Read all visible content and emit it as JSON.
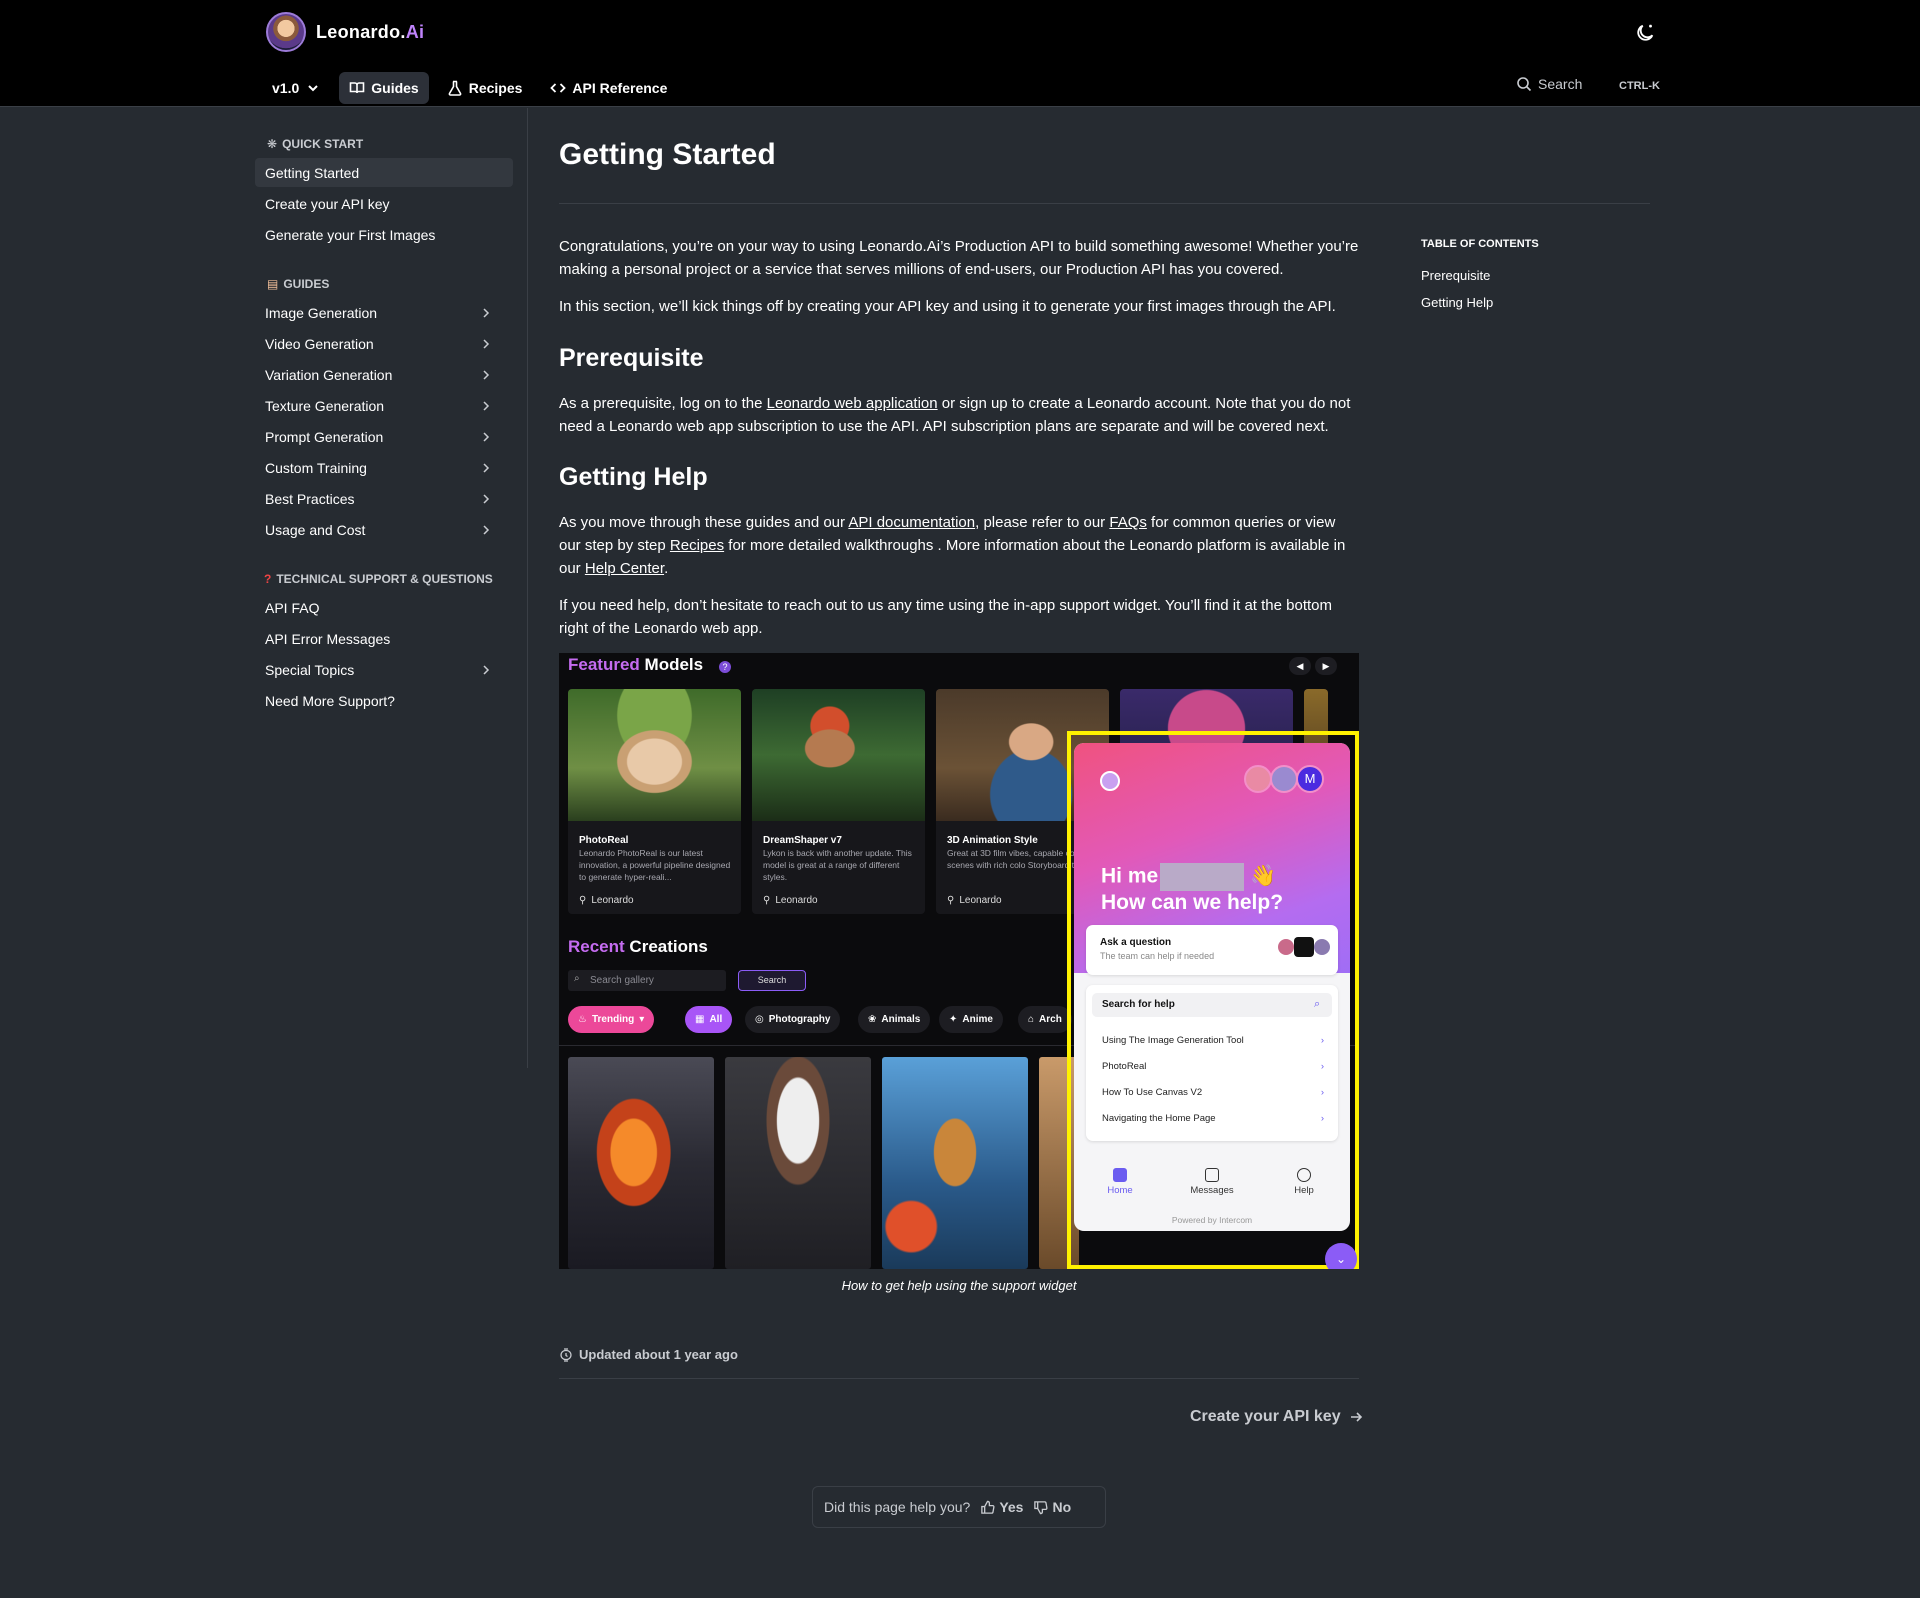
{
  "header": {
    "brand": "Leonardo.",
    "brand_ai": "Ai",
    "version": "v1.0",
    "nav": [
      "Guides",
      "Recipes",
      "API Reference"
    ],
    "search_label": "Search",
    "shortcut": "CTRL-K"
  },
  "sidebar": {
    "quick_start_title": "QUICK START",
    "quick_start": [
      "Getting Started",
      "Create your API key",
      "Generate your First Images"
    ],
    "guides_title": "GUIDES",
    "guides": [
      "Image Generation",
      "Video Generation",
      "Variation Generation",
      "Texture Generation",
      "Prompt Generation",
      "Custom Training",
      "Best Practices",
      "Usage and Cost"
    ],
    "support_title": "TECHNICAL SUPPORT & QUESTIONS",
    "support": [
      "API FAQ",
      "API Error Messages",
      "Special Topics",
      "Need More Support?"
    ]
  },
  "main": {
    "title": "Getting Started",
    "intro_1": "Congratulations, you’re on your way to using Leonardo.Ai’s Production API to build something awesome! Whether you’re making a personal project or a service that serves millions of end-users, our Production API has you covered.",
    "intro_2": "In this section, we’ll kick things off by creating your API key and using it to generate your first images through the API.",
    "prereq_title": "Prerequisite",
    "prereq_a": "As a prerequisite, log on to the ",
    "prereq_link": "Leonardo web application",
    "prereq_b": " or sign up to create a Leonardo account. Note that you do not need a Leonardo web app subscription to use the API. API subscription plans are separate and will be covered next.",
    "help_title": "Getting Help",
    "help_a": "As you move through these guides and our ",
    "help_link_docs": "API documentation",
    "help_b": ", please refer to our ",
    "help_link_faq": "FAQs",
    "help_c": " for common queries or view our step by step ",
    "help_link_recipes": "Recipes",
    "help_d": " for more detailed walkthroughs . More information about the Leonardo platform is available in our ",
    "help_link_center": "Help Center",
    "help_e": ".",
    "help_2": "If you need help, don’t hesitate to reach out to us any time using the in-app support widget. You’ll find it at the bottom right of the Leonardo web app.",
    "caption": "How to get help using the support widget",
    "updated": "Updated about 1 year ago",
    "next": "Create your API key",
    "feedback_q": "Did this page help you?",
    "yes": "Yes",
    "no": "No"
  },
  "toc": {
    "title": "TABLE OF CONTENTS",
    "items": [
      "Prerequisite",
      "Getting Help"
    ]
  },
  "figure": {
    "featured_a": "Featured",
    "featured_b": "Models",
    "cards": [
      {
        "name": "PhotoReal",
        "desc": "Leonardo PhotoReal is our latest innovation, a powerful pipeline designed to generate hyper-reali...",
        "user": "Leonardo"
      },
      {
        "name": "DreamShaper v7",
        "desc": "Lykon is back with another update. This model is great at a range of different styles.",
        "user": "Leonardo"
      },
      {
        "name": "3D Animation Style",
        "desc": "Great at 3D film vibes, capable complex scenes with rich colo Storyboard time!",
        "user": "Leonardo"
      }
    ],
    "recent_a": "Recent",
    "recent_b": "Creations",
    "search_placeholder": "Search gallery",
    "search_btn": "Search",
    "chips": [
      "Trending",
      "All",
      "Photography",
      "Animals",
      "Anime",
      "Arch"
    ],
    "widget": {
      "hi": "Hi me",
      "help": "How can we help?",
      "avatar_m": "M",
      "ask_title": "Ask a question",
      "ask_sub": "The team can help if needed",
      "search_help": "Search for help",
      "links": [
        "Using The Image Generation Tool",
        "PhotoReal",
        "How To Use Canvas V2",
        "Navigating the Home Page"
      ],
      "tabs": [
        "Home",
        "Messages",
        "Help"
      ],
      "powered": "Powered by Intercom"
    }
  }
}
